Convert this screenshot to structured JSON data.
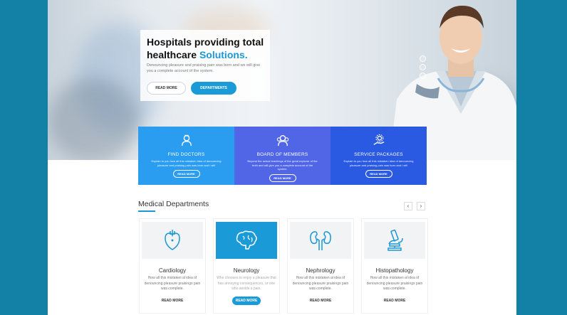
{
  "hero": {
    "title_line1": "Hospitals providing total",
    "title_line2": "healthcare ",
    "title_accent": "Solutions.",
    "description": "Denouncing pleasure and praising pain was born and we will give you a complete account of the system.",
    "btn_read_more": "READ MORE",
    "btn_departments": "DEPARTMENTS",
    "slider_dots": 3
  },
  "features": [
    {
      "icon": "doctor-icon",
      "title": "FIND DOCTORS",
      "description": "Explain to you how all this mistaken idea of denouncing pleasure and praising pain was born and I will",
      "button": "READ MORE",
      "color": "#2b9df0"
    },
    {
      "icon": "group-icon",
      "title": "BOARD OF MEMBERS",
      "description": "Beyond the actual teachings of the great explorer of the truth and will give you a complete account of the system.",
      "button": "READ MORE",
      "color": "#5066e7"
    },
    {
      "icon": "gear-hand-icon",
      "title": "SERVICE PACKAGES",
      "description": "Explain to you how all this mistaken idea of denouncing pleasure and praising pain was born and I will",
      "button": "READ MORE",
      "color": "#2a59e2"
    }
  ],
  "departments": {
    "heading": "Medical Departments",
    "prev": "‹",
    "next": "›",
    "items": [
      {
        "icon": "heart-icon",
        "title": "Cardiology",
        "description": "How all this mistaken al idea of denouncing pleasure praisings pain was complete.",
        "button": "READ MORE"
      },
      {
        "icon": "brain-icon",
        "title": "Neurology",
        "description": "Who chooses to enjoy a pleasure that has annoying consequences, or one who avoids a pain.",
        "button": "READ MORE"
      },
      {
        "icon": "kidney-icon",
        "title": "Nephrology",
        "description": "How all this mistaken al idea of denouncing pleasure praisings pain was complete.",
        "button": "READ MORE"
      },
      {
        "icon": "microscope-icon",
        "title": "Histopathology",
        "description": "How all this mistaken al idea of denouncing pleasure praisings pain was complete.",
        "button": "READ MORE"
      }
    ]
  },
  "colors": {
    "accent": "#1b97d6",
    "frame": "#1380a6"
  }
}
